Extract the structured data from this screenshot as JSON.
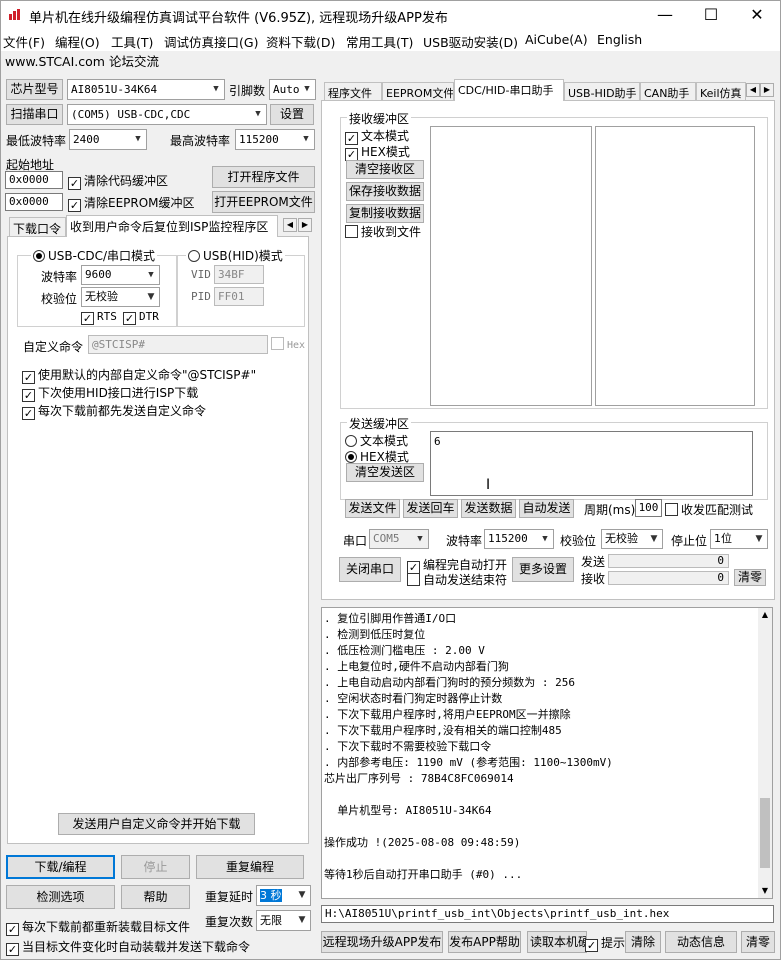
{
  "window": {
    "title": "单片机在线升级编程仿真调试平台软件 (V6.95Z), 远程现场升级APP发布",
    "min": "—",
    "max": "☐",
    "close": "✕"
  },
  "menu": [
    "文件(F)",
    "编程(O)",
    "工具(T)",
    "调试仿真接口(G)",
    "资料下载(D)",
    "常用工具(T)",
    "USB驱动安装(D)",
    "AiCube(A)",
    "English"
  ],
  "site_link": "www.STCAI.com 论坛交流",
  "left": {
    "chip_label": "芯片型号",
    "chip_value": "AI8051U-34K64",
    "pins_label": "引脚数",
    "pins_value": "Auto",
    "scan_label": "扫描串口",
    "port_value": "(COM5) USB-CDC,CDC",
    "settings_label": "设置",
    "min_baud_label": "最低波特率",
    "min_baud": "2400",
    "max_baud_label": "最高波特率",
    "max_baud": "115200",
    "start_addr_label": "起始地址",
    "addr1": "0x0000",
    "clear_code": "清除代码缓冲区",
    "open_prog": "打开程序文件",
    "addr2": "0x0000",
    "clear_eeprom": "清除EEPROM缓冲区",
    "open_eeprom": "打开EEPROM文件",
    "tabs": [
      "下载口令",
      "收到用户命令后复位到ISP监控程序区"
    ],
    "cdc_mode": "USB-CDC/串口模式",
    "hid_mode": "USB(HID)模式",
    "baud_label": "波特率",
    "baud_value": "9600",
    "parity_label": "校验位",
    "parity_value": "无校验",
    "rts": "RTS",
    "dtr": "DTR",
    "vid_label": "VID",
    "vid": "34BF",
    "pid_label": "PID",
    "pid": "FF01",
    "custom_cmd_label": "自定义命令",
    "custom_cmd": "@STCISP#",
    "hex_label": "Hex",
    "opt1": "使用默认的内部自定义命令\"@STCISP#\"",
    "opt2": "下次使用HID接口进行ISP下载",
    "opt3": "每次下载前都先发送自定义命令",
    "send_custom": "发送用户自定义命令并开始下载",
    "download": "下载/编程",
    "stop": "停止",
    "reprogram": "重复编程",
    "detect": "检测选项",
    "help": "帮助",
    "delay_label": "重复延时",
    "delay_value": "3 秒",
    "count_label": "重复次数",
    "count_value": "无限",
    "reload1": "每次下载前都重新装载目标文件",
    "reload2": "当目标文件变化时自动装载并发送下载命令"
  },
  "right": {
    "tabs": [
      "程序文件",
      "EEPROM文件",
      "CDC/HID-串口助手",
      "USB-HID助手",
      "CAN助手",
      "Keil仿真"
    ],
    "recv_group": "接收缓冲区",
    "text_mode": "文本模式",
    "hex_mode": "HEX模式",
    "clear_recv": "清空接收区",
    "save_recv": "保存接收数据",
    "copy_recv": "复制接收数据",
    "recv_file": "接收到文件",
    "send_group": "发送缓冲区",
    "send_text": "6",
    "clear_send": "清空发送区",
    "send_file": "发送文件",
    "send_back": "发送回车",
    "send_data": "发送数据",
    "auto_send": "自动发送",
    "period_label": "周期(ms)",
    "period": "100",
    "match_test": "收发匹配测试",
    "port_label": "串口",
    "port": "COM5",
    "baud_label": "波特率",
    "baud": "115200",
    "parity_label": "校验位",
    "parity": "无校验",
    "stop_label": "停止位",
    "stop": "1位",
    "close_port": "关闭串口",
    "auto_open": "编程完自动打开",
    "auto_end": "自动发送结束符",
    "more": "更多设置",
    "send_count_label": "发送",
    "send_count": "0",
    "recv_count_label": "接收",
    "recv_count": "0",
    "clear_counts": "清零"
  },
  "log": [
    ". 复位引脚用作普通I/O口",
    ". 检测到低压时复位",
    ". 低压检测门槛电压 : 2.00 V",
    ". 上电复位时,硬件不启动内部看门狗",
    ". 上电自动启动内部看门狗时的预分频数为 : 256",
    ". 空闲状态时看门狗定时器停止计数",
    ". 下次下载用户程序时,将用户EEPROM区一并擦除",
    ". 下次下载用户程序时,没有相关的端口控制485",
    ". 下次下载时不需要校验下载口令",
    ". 内部参考电压: 1190 mV (参考范围: 1100~1300mV)",
    "芯片出厂序列号 : 78B4C8FC069014",
    "",
    "  单片机型号: AI8051U-34K64",
    "",
    "操作成功 !(2025-08-08 09:48:59)",
    "",
    "等待1秒后自动打开串口助手 (#0) ..."
  ],
  "path": "H:\\AI8051U\\printf_usb_int\\Objects\\printf_usb_int.hex",
  "bottom": {
    "remote": "远程现场升级APP发布",
    "publish_help": "发布APP帮助",
    "read_sn": "读取本机硬",
    "hint": "提示",
    "clear": "清除",
    "dynamic": "动态信息",
    "clear2": "清零"
  }
}
